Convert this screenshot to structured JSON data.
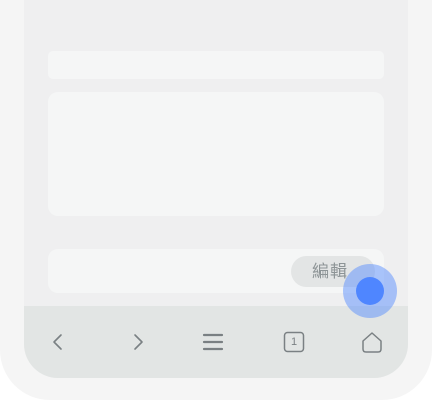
{
  "content": {
    "edit_button_label": "編輯"
  },
  "toolbar": {
    "tab_count": "1",
    "icons": [
      "back-icon",
      "forward-icon",
      "menu-icon",
      "tabs-icon",
      "home-icon"
    ]
  },
  "colors": {
    "frame": "#f5f5f5",
    "screen_bg": "#efeff0",
    "card_bg": "#f5f6f6",
    "toolbar_bg": "#e2e5e4",
    "icon": "#7a8083",
    "touch_indicator": "#4f86ff"
  }
}
